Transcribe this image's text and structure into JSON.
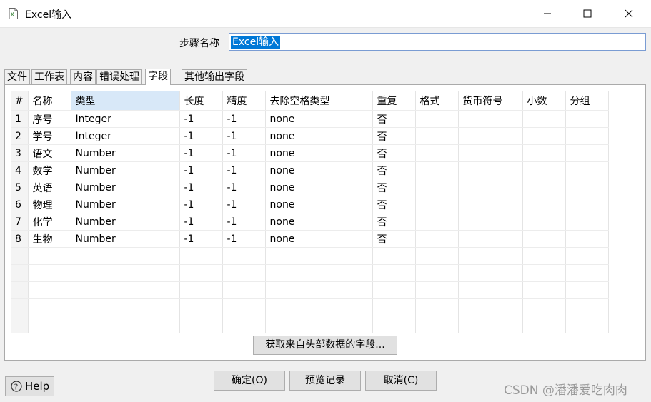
{
  "window": {
    "title": "Excel输入",
    "icons": {
      "app": "spreadsheet-file-icon",
      "minimize": "minimize-icon",
      "maximize": "maximize-icon",
      "close": "close-icon"
    }
  },
  "step": {
    "label": "步骤名称",
    "value": "Excel输入"
  },
  "tabs": [
    {
      "label": "文件",
      "active": false
    },
    {
      "label": "工作表",
      "active": false
    },
    {
      "label": "内容",
      "active": false
    },
    {
      "label": "错误处理",
      "active": false
    },
    {
      "label": "字段",
      "active": true
    },
    {
      "label": "其他输出字段",
      "active": false
    }
  ],
  "grid": {
    "columns": [
      "#",
      "名称",
      "类型",
      "长度",
      "精度",
      "去除空格类型",
      "重复",
      "格式",
      "货币符号",
      "小数",
      "分组"
    ],
    "selected_column": "类型",
    "rows": [
      [
        "1",
        "序号",
        "Integer",
        "-1",
        "-1",
        "none",
        "否",
        "",
        "",
        "",
        ""
      ],
      [
        "2",
        "学号",
        "Integer",
        "-1",
        "-1",
        "none",
        "否",
        "",
        "",
        "",
        ""
      ],
      [
        "3",
        "语文",
        "Number",
        "-1",
        "-1",
        "none",
        "否",
        "",
        "",
        "",
        ""
      ],
      [
        "4",
        "数学",
        "Number",
        "-1",
        "-1",
        "none",
        "否",
        "",
        "",
        "",
        ""
      ],
      [
        "5",
        "英语",
        "Number",
        "-1",
        "-1",
        "none",
        "否",
        "",
        "",
        "",
        ""
      ],
      [
        "6",
        "物理",
        "Number",
        "-1",
        "-1",
        "none",
        "否",
        "",
        "",
        "",
        ""
      ],
      [
        "7",
        "化学",
        "Number",
        "-1",
        "-1",
        "none",
        "否",
        "",
        "",
        "",
        ""
      ],
      [
        "8",
        "生物",
        "Number",
        "-1",
        "-1",
        "none",
        "否",
        "",
        "",
        "",
        ""
      ]
    ],
    "empty_rows": 5
  },
  "buttons": {
    "fetch_fields": "获取来自头部数据的字段...",
    "help": "Help",
    "ok": "确定(O)",
    "preview": "预览记录",
    "cancel": "取消(C)"
  },
  "watermark": "CSDN @潘潘爱吃肉肉",
  "colors": {
    "selection": "#0078d7",
    "header_selected": "#d8e8f8"
  }
}
